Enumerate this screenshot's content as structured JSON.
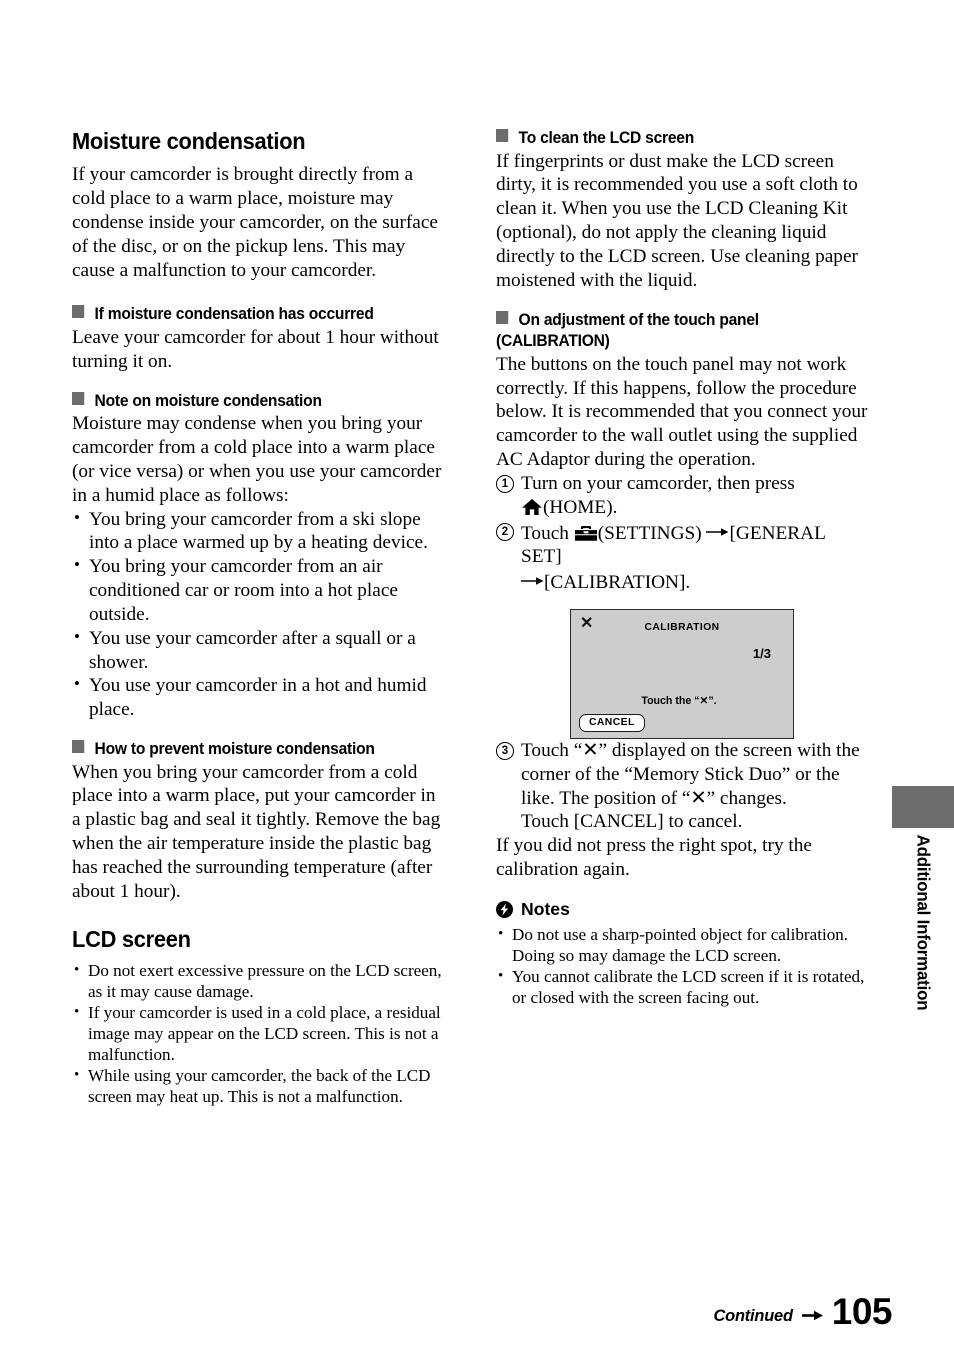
{
  "document": {
    "page_number": "105",
    "continued_label": "Continued",
    "side_tab_label": "Additional Information"
  },
  "left_column": {
    "moisture": {
      "title": "Moisture condensation",
      "intro": "If your camcorder is brought directly from a cold place to a warm place, moisture may condense inside your camcorder, on the surface of the disc, or on the pickup lens. This may cause a malfunction to your camcorder.",
      "occurred": {
        "heading": "If moisture condensation has occurred",
        "text": "Leave your camcorder for about 1 hour without turning it on."
      },
      "note": {
        "heading": "Note on moisture condensation",
        "intro": "Moisture may condense when you bring your camcorder from a cold place into a warm place (or vice versa) or when you use your camcorder in a humid place as follows:",
        "bullets": [
          "You bring your camcorder from a ski slope into a place warmed up by a heating device.",
          "You bring your camcorder from an air conditioned car or room into a hot place outside.",
          "You use your camcorder after a squall or a shower.",
          "You use your camcorder in a hot and humid place."
        ]
      },
      "prevent": {
        "heading": "How to prevent moisture condensation",
        "text": "When you bring your camcorder from a cold place into a warm place, put your camcorder in a plastic bag and seal it tightly. Remove the bag when the air temperature inside the plastic bag has reached the surrounding temperature (after about 1 hour)."
      }
    },
    "lcd_screen": {
      "title": "LCD screen",
      "bullets": [
        "Do not exert excessive pressure on the LCD screen, as it may cause damage.",
        "If your camcorder is used in a cold place, a residual image may appear on the LCD screen. This is not a malfunction.",
        "While using your camcorder, the back of the LCD screen may heat up. This is not a malfunction."
      ]
    }
  },
  "right_column": {
    "clean": {
      "heading": "To clean the LCD screen",
      "text": "If fingerprints or dust make the LCD screen dirty, it is recommended you use a soft cloth to clean it. When you use the LCD Cleaning Kit (optional), do not apply the cleaning liquid directly to the LCD screen. Use cleaning paper moistened with the liquid."
    },
    "calibration": {
      "heading_line1": "On adjustment of the touch panel",
      "heading_line2": "(CALIBRATION)",
      "intro": "The buttons on the touch panel may not work correctly. If this happens, follow the procedure below. It is recommended that you connect your camcorder to the wall outlet using the supplied AC Adaptor during the operation.",
      "steps": [
        {
          "number": "1",
          "text_before_icon": "Turn on your camcorder, then press",
          "icon": "home-icon",
          "text_after_icon": "(HOME)."
        },
        {
          "number": "2",
          "text_before_icon": "Touch",
          "icon": "settings-toolbox-icon",
          "text_after_icon": "(SETTINGS)",
          "text_part2": "[GENERAL SET]",
          "text_part3": "[CALIBRATION]."
        },
        {
          "number": "3",
          "text": "Touch “✕” displayed on the screen with the corner of the “Memory Stick Duo” or the like. The position of “✕” changes.",
          "text_line2": "Touch [CANCEL] to cancel."
        }
      ],
      "figure": {
        "close_mark": "✕",
        "title": "CALIBRATION",
        "page_indicator": "1/3",
        "instruction": "Touch the “✕”.",
        "cancel_button": "CANCEL",
        "background_color": "#cdcdcd",
        "border_color": "#2b2b2b"
      },
      "after_text": "If you did not press the right spot, try the calibration again."
    },
    "notes": {
      "heading": "Notes",
      "icon": "note-bolt-icon",
      "bullets": [
        "Do not use a sharp-pointed object for calibration. Doing so may damage the LCD screen.",
        "You cannot calibrate the LCD screen if it is rotated, or closed with the screen facing out."
      ]
    }
  },
  "colors": {
    "square_bullet": "#6d6d6d",
    "side_tab": "#6d6d6d",
    "text": "#000000"
  }
}
